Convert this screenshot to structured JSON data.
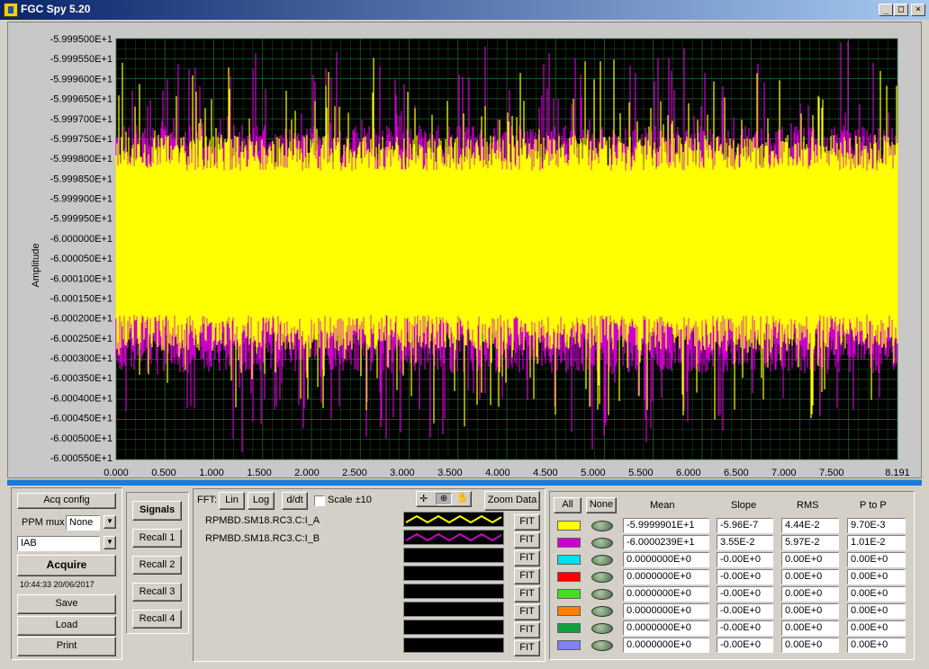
{
  "window": {
    "title": "FGC Spy 5.20",
    "min_btn": "_",
    "max_btn": "□",
    "close_btn": "×"
  },
  "graph": {
    "y_axis_label": "Amplitude",
    "y_ticks": [
      "-5.999500E+1",
      "-5.999550E+1",
      "-5.999600E+1",
      "-5.999650E+1",
      "-5.999700E+1",
      "-5.999750E+1",
      "-5.999800E+1",
      "-5.999850E+1",
      "-5.999900E+1",
      "-5.999950E+1",
      "-6.000000E+1",
      "-6.000050E+1",
      "-6.000100E+1",
      "-6.000150E+1",
      "-6.000200E+1",
      "-6.000250E+1",
      "-6.000300E+1",
      "-6.000350E+1",
      "-6.000400E+1",
      "-6.000450E+1",
      "-6.000500E+1",
      "-6.000550E+1"
    ],
    "x_ticks": [
      "0.000",
      "0.500",
      "1.000",
      "1.500",
      "2.000",
      "2.500",
      "3.000",
      "3.500",
      "4.000",
      "4.500",
      "5.000",
      "5.500",
      "6.000",
      "6.500",
      "7.000",
      "7.500",
      "8.191"
    ],
    "colors": {
      "background": "#000000",
      "grid": "#1f6a2a",
      "series_a": "#ffff00",
      "series_b": "#cc00cc"
    }
  },
  "left_panel": {
    "acq_config": "Acq config",
    "ppm_mux_label": "PPM mux",
    "ppm_mux_value": "None",
    "signal_select": "IAB",
    "acquire": "Acquire",
    "timestamp": "10:44:33 20/06/2017",
    "save": "Save",
    "load": "Load",
    "print": "Print"
  },
  "recall_panel": {
    "signals": "Signals",
    "recall": [
      "Recall 1",
      "Recall 2",
      "Recall 3",
      "Recall 4"
    ]
  },
  "fft_panel": {
    "fft_label": "FFT:",
    "lin": "Lin",
    "log": "Log",
    "ddt": "d/dt",
    "scale_label": "Scale ±10",
    "zoom_data": "Zoom Data",
    "fit_label": "FIT",
    "signals": [
      {
        "name": "RPMBD.SM18.RC3.C:I_A",
        "color": "#ffff00"
      },
      {
        "name": "RPMBD.SM18.RC3.C:I_B",
        "color": "#cc00cc"
      },
      {
        "name": "",
        "color": ""
      },
      {
        "name": "",
        "color": ""
      },
      {
        "name": "",
        "color": ""
      },
      {
        "name": "",
        "color": ""
      },
      {
        "name": "",
        "color": ""
      },
      {
        "name": "",
        "color": ""
      }
    ]
  },
  "stats_panel": {
    "all": "All",
    "none": "None",
    "headers": {
      "mean": "Mean",
      "slope": "Slope",
      "rms": "RMS",
      "ptop": "P to P"
    },
    "rows": [
      {
        "color": "#ffff00",
        "mean": "-5.9999901E+1",
        "slope": "-5.96E-7",
        "rms": "4.44E-2",
        "ptop": "9.70E-3"
      },
      {
        "color": "#cc00cc",
        "mean": "-6.0000239E+1",
        "slope": "3.55E-2",
        "rms": "5.97E-2",
        "ptop": "1.01E-2"
      },
      {
        "color": "#00e0f0",
        "mean": "0.0000000E+0",
        "slope": "-0.00E+0",
        "rms": "0.00E+0",
        "ptop": "0.00E+0"
      },
      {
        "color": "#ff0000",
        "mean": "0.0000000E+0",
        "slope": "-0.00E+0",
        "rms": "0.00E+0",
        "ptop": "0.00E+0"
      },
      {
        "color": "#40e020",
        "mean": "0.0000000E+0",
        "slope": "-0.00E+0",
        "rms": "0.00E+0",
        "ptop": "0.00E+0"
      },
      {
        "color": "#ff8000",
        "mean": "0.0000000E+0",
        "slope": "-0.00E+0",
        "rms": "0.00E+0",
        "ptop": "0.00E+0"
      },
      {
        "color": "#10a040",
        "mean": "0.0000000E+0",
        "slope": "-0.00E+0",
        "rms": "0.00E+0",
        "ptop": "0.00E+0"
      },
      {
        "color": "#8080f0",
        "mean": "0.0000000E+0",
        "slope": "-0.00E+0",
        "rms": "0.00E+0",
        "ptop": "0.00E+0"
      }
    ]
  }
}
